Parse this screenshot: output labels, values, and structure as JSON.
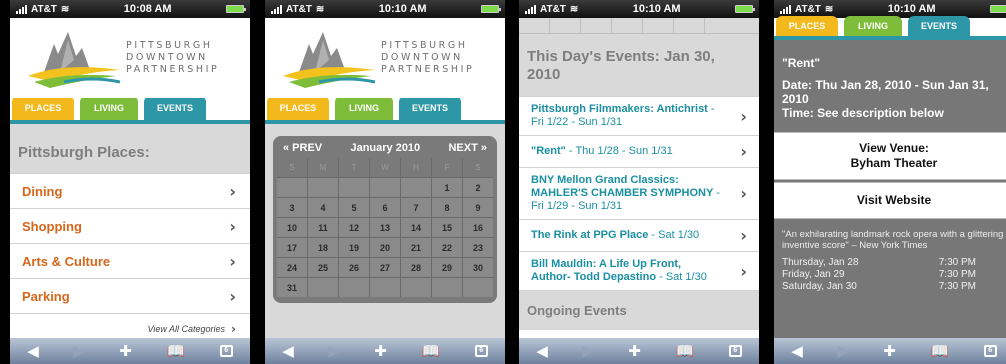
{
  "status": {
    "carrier": "AT&T",
    "times": [
      "10:08 AM",
      "10:10 AM",
      "10:10 AM",
      "10:10 AM"
    ]
  },
  "logo": {
    "line1": "PITTSBURGH",
    "line2": "DOWNTOWN",
    "line3": "PARTNERSHIP"
  },
  "tabs": {
    "places": "PLACES",
    "living": "LIVING",
    "events": "EVENTS"
  },
  "places_screen": {
    "title": "Pittsburgh Places:",
    "items": [
      "Dining",
      "Shopping",
      "Arts & Culture",
      "Parking"
    ],
    "view_all": "View All Categories"
  },
  "calendar_screen": {
    "prev": "« PREV",
    "month": "January 2010",
    "next": "NEXT »",
    "weekdays": [
      "S",
      "M",
      "T",
      "W",
      "H",
      "F",
      "S"
    ],
    "weeks": [
      [
        "",
        "",
        "",
        "",
        "",
        "1",
        "2"
      ],
      [
        "3",
        "4",
        "5",
        "6",
        "7",
        "8",
        "9"
      ],
      [
        "10",
        "11",
        "12",
        "13",
        "14",
        "15",
        "16"
      ],
      [
        "17",
        "18",
        "19",
        "20",
        "21",
        "22",
        "23"
      ],
      [
        "24",
        "25",
        "26",
        "27",
        "28",
        "29",
        "30"
      ],
      [
        "31",
        "",
        "",
        "",
        "",
        "",
        ""
      ]
    ]
  },
  "events_screen": {
    "title": "This Day's Events: Jan 30, 2010",
    "events": [
      {
        "name": "Pittsburgh Filmmakers: Antichrist",
        "date": " - Fri 1/22 - Sun 1/31"
      },
      {
        "name": "\"Rent\"",
        "date": " - Thu 1/28 - Sun 1/31"
      },
      {
        "name": "BNY Mellon Grand Classics: MAHLER'S CHAMBER SYMPHONY",
        "date": " - Fri 1/29 - Sun 1/31"
      },
      {
        "name": "The Rink at PPG Place",
        "date": " - Sat 1/30"
      },
      {
        "name": "Bill Mauldin: A Life Up Front, Author- Todd Depastino",
        "date": " - Sat 1/30"
      }
    ],
    "ongoing": "Ongoing Events"
  },
  "detail_screen": {
    "heading": "\"Rent\"",
    "date_line": "Date: Thu Jan 28, 2010 - Sun Jan 31, 2010",
    "time_line": "Time: See description below",
    "venue_label": "View Venue:",
    "venue_name": "Byham Theater",
    "website_label": "Visit Website",
    "quote": "\"An exhilarating landmark rock opera with a glittering inventive score\" – New York Times",
    "times": [
      {
        "day": "Thursday, Jan 28",
        "time": "7:30 PM"
      },
      {
        "day": "Friday, Jan 29",
        "time": "7:30 PM"
      },
      {
        "day": "Saturday, Jan 30",
        "time": "7:30 PM"
      }
    ]
  },
  "toolbar": {
    "pages_count": "6"
  },
  "colors": {
    "places": "#f3b81c",
    "living": "#7dbd3a",
    "events": "#2e97a7",
    "link_orange": "#d5661c",
    "link_teal": "#1b8fa2"
  }
}
